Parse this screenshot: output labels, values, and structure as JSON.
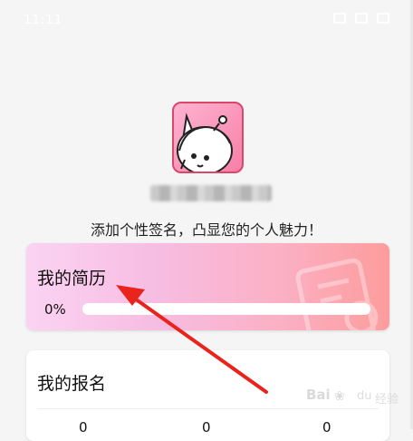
{
  "status_bar": {
    "time": "11:11"
  },
  "profile": {
    "signature_prompt": "添加个性签名，凸显您的个人魅力！"
  },
  "resume_card": {
    "title": "我的简历",
    "progress_label": "0%",
    "progress": 0
  },
  "signup_card": {
    "title": "我的报名",
    "counts": [
      "0",
      "0",
      "0"
    ]
  },
  "watermark": {
    "brand": "Bai",
    "suffix": "du",
    "sub": "经验"
  },
  "colors": {
    "annotation_arrow": "#e8241c",
    "resume_gradient_start": "#fbd3f2",
    "resume_gradient_end": "#fd9c9c",
    "avatar_border": "#d9476b"
  },
  "icons": {
    "avatar": "cartoon-cat-avatar",
    "resume_background": "document-magnifier-icon"
  }
}
